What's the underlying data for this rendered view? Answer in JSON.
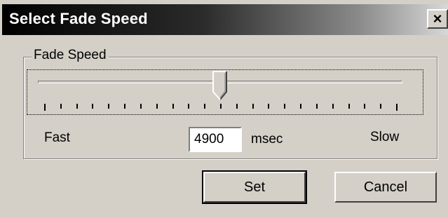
{
  "window": {
    "title": "Select Fade Speed",
    "close_label": "×"
  },
  "group": {
    "label": "Fade Speed"
  },
  "slider": {
    "value_fraction": 0.5,
    "tick_count": 23
  },
  "labels": {
    "fast": "Fast",
    "slow": "Slow",
    "unit": "msec"
  },
  "speed_input": {
    "value": "4900"
  },
  "buttons": {
    "set": "Set",
    "cancel": "Cancel"
  },
  "colors": {
    "face": "#d4d0c8",
    "title_start": "#000000",
    "title_end": "#d8d8d8"
  }
}
